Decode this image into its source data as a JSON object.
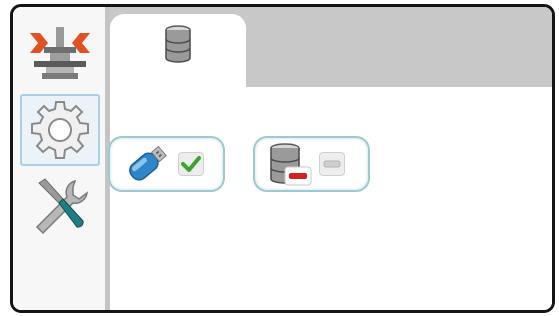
{
  "sidebar": {
    "items": [
      {
        "icon": "compress-tool-icon",
        "selected": false
      },
      {
        "icon": "gear-icon",
        "selected": true
      },
      {
        "icon": "tools-icon",
        "selected": false
      }
    ]
  },
  "tabs": [
    {
      "icon": "database-icon",
      "active": true
    }
  ],
  "content": {
    "tiles": [
      {
        "icon": "usb-drive-icon",
        "status_icon": "checkmark-icon",
        "status": "connected"
      },
      {
        "icon": "database-remove-icon",
        "status_icon": "minus-icon",
        "status": "disabled"
      }
    ]
  },
  "colors": {
    "tab_strip": "#c8c8c8",
    "selected_border": "#a9cfe6",
    "tile_border": "#9ec9cf",
    "check_green": "#3aa52c",
    "remove_red": "#d32020",
    "usb_blue": "#2e86c9"
  }
}
